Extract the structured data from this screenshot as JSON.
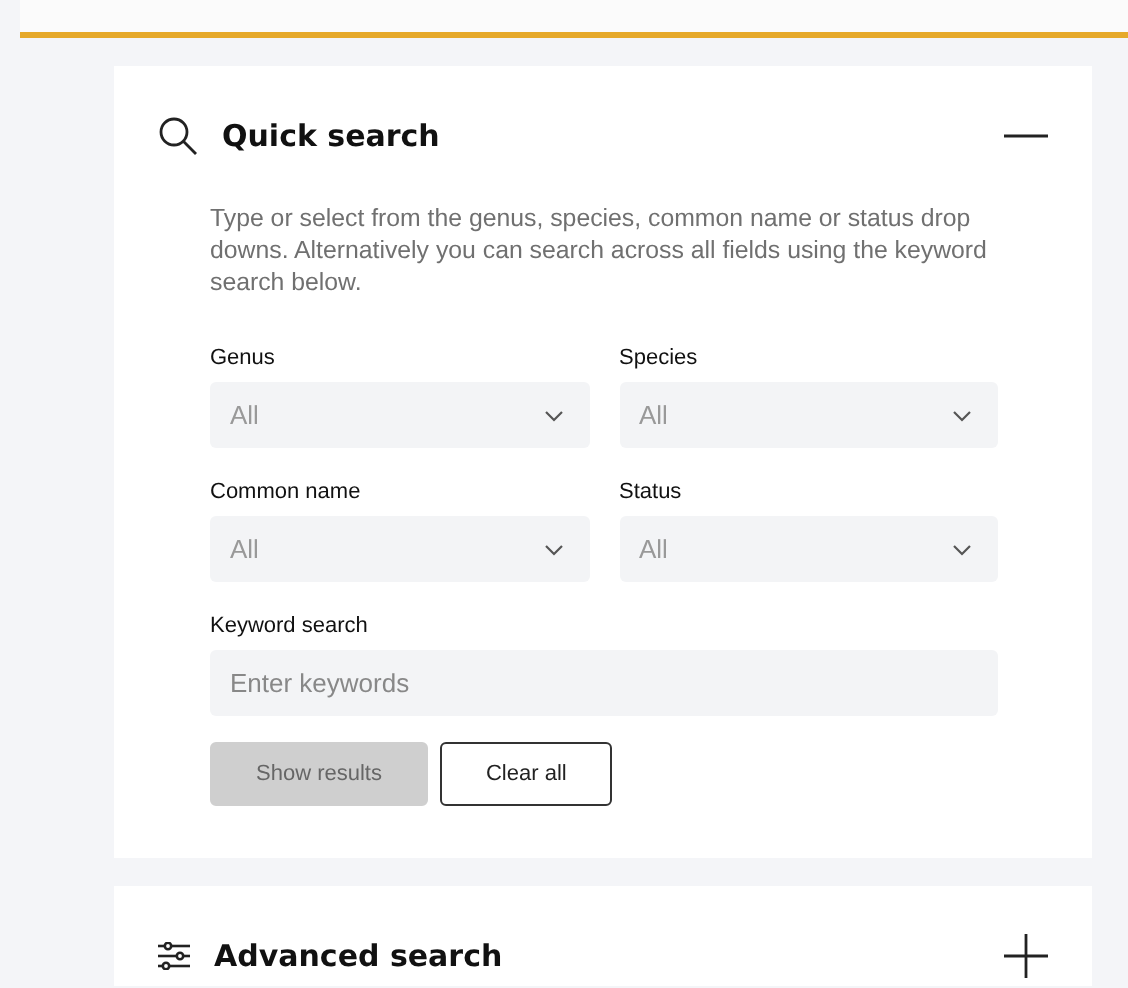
{
  "panels": [
    {
      "kind": "search",
      "title": "Quick search",
      "expanded": true,
      "description": "Type or select from the genus, species, common name or status drop downs. Alternatively you can search across all fields using the keyword search below.",
      "dropdowns": [
        {
          "label": "Genus",
          "value": "All"
        },
        {
          "label": "Species",
          "value": "All"
        },
        {
          "label": "Common name",
          "value": "All"
        },
        {
          "label": "Status",
          "value": "All"
        }
      ],
      "keyword": {
        "label": "Keyword search",
        "placeholder": "Enter keywords"
      },
      "buttons": [
        {
          "label": "Show results",
          "kind": "primary",
          "disabled": true
        },
        {
          "label": "Clear all",
          "kind": "outline",
          "disabled": false
        }
      ]
    },
    {
      "kind": "filters",
      "title": "Advanced search",
      "expanded": false
    }
  ]
}
